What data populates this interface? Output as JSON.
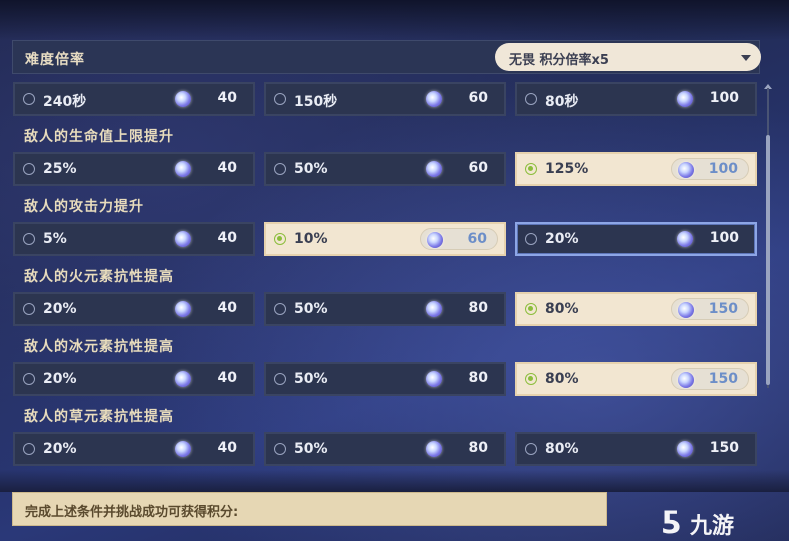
{
  "header": {
    "title": "难度倍率",
    "dropdown_value": "无畏  积分倍率x5"
  },
  "rows": [
    {
      "label": "",
      "options": [
        {
          "label": "240秒",
          "points": "40",
          "selected": false
        },
        {
          "label": "150秒",
          "points": "60",
          "selected": false
        },
        {
          "label": "80秒",
          "points": "100",
          "selected": false
        }
      ]
    },
    {
      "label": "敌人的生命值上限提升",
      "options": [
        {
          "label": "25%",
          "points": "40",
          "selected": false
        },
        {
          "label": "50%",
          "points": "60",
          "selected": false
        },
        {
          "label": "125%",
          "points": "100",
          "selected": true
        }
      ]
    },
    {
      "label": "敌人的攻击力提升",
      "options": [
        {
          "label": "5%",
          "points": "40",
          "selected": false
        },
        {
          "label": "10%",
          "points": "60",
          "selected": true
        },
        {
          "label": "20%",
          "points": "100",
          "selected": false,
          "hover": true
        }
      ]
    },
    {
      "label": "敌人的火元素抗性提高",
      "options": [
        {
          "label": "20%",
          "points": "40",
          "selected": false
        },
        {
          "label": "50%",
          "points": "80",
          "selected": false
        },
        {
          "label": "80%",
          "points": "150",
          "selected": true
        }
      ]
    },
    {
      "label": "敌人的冰元素抗性提高",
      "options": [
        {
          "label": "20%",
          "points": "40",
          "selected": false
        },
        {
          "label": "50%",
          "points": "80",
          "selected": false
        },
        {
          "label": "80%",
          "points": "150",
          "selected": true
        }
      ]
    },
    {
      "label": "敌人的草元素抗性提高",
      "options": [
        {
          "label": "20%",
          "points": "40",
          "selected": false
        },
        {
          "label": "50%",
          "points": "80",
          "selected": false
        },
        {
          "label": "80%",
          "points": "150",
          "selected": false
        }
      ]
    }
  ],
  "footer": {
    "text": "完成上述条件并挑战成功可获得积分:"
  },
  "watermark": {
    "text": "九游"
  },
  "icons": {
    "points": "primogem-icon",
    "dropdown": "chevron-down-icon"
  }
}
